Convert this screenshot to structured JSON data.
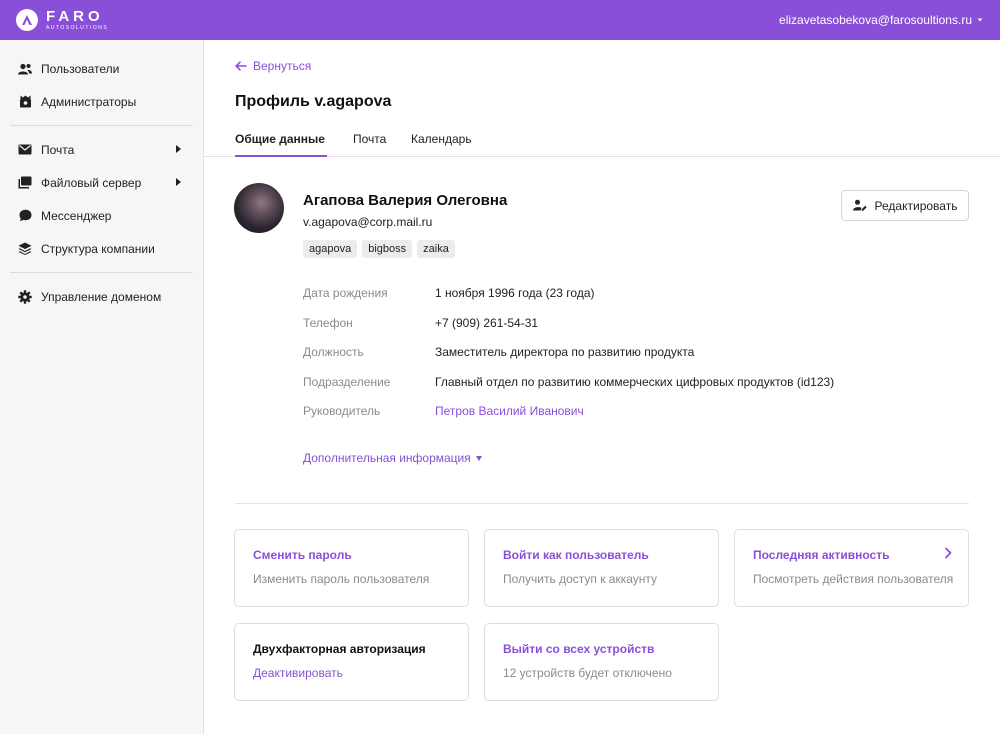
{
  "header": {
    "brand_name": "FARO",
    "brand_sub": "AUTOSOLUTIONS",
    "account_email": "elizavetasobekova@farosoultions.ru"
  },
  "sidebar": {
    "items": [
      {
        "label": "Пользователи",
        "icon": "users-icon"
      },
      {
        "label": "Администраторы",
        "icon": "admins-icon"
      },
      {
        "label": "Почта",
        "icon": "mail-icon"
      },
      {
        "label": "Файловый сервер",
        "icon": "files-icon"
      },
      {
        "label": "Мессенджер",
        "icon": "chat-icon"
      },
      {
        "label": "Структура компании",
        "icon": "layers-icon"
      },
      {
        "label": "Управление доменом",
        "icon": "gear-icon"
      }
    ]
  },
  "main": {
    "back_label": "Вернуться",
    "page_title": "Профиль v.agapova",
    "tabs": [
      {
        "label": "Общие данные"
      },
      {
        "label": "Почта"
      },
      {
        "label": "Календарь"
      }
    ],
    "profile": {
      "full_name": "Агапова Валерия Олеговна",
      "email": "v.agapova@corp.mail.ru",
      "tags": [
        "agapova",
        "bigboss",
        "zaika"
      ],
      "edit_label": "Редактировать"
    },
    "fields": [
      {
        "label": "Дата рождения",
        "value": "1 ноября 1996 года (23 года)"
      },
      {
        "label": "Телефон",
        "value": "+7 (909) 261-54-31"
      },
      {
        "label": "Должность",
        "value": "Заместитель директора по развитию продукта"
      },
      {
        "label": "Подразделение",
        "value": "Главный отдел по развитию коммерческих цифровых продуктов (id123)"
      },
      {
        "label": "Руководитель",
        "value": "Петров Василий Иванович"
      }
    ],
    "more_info_label": "Дополнительная информация",
    "cards": [
      {
        "title": "Сменить пароль",
        "subtitle": "Изменить пароль пользователя"
      },
      {
        "title": "Войти как пользователь",
        "subtitle": "Получить доступ к аккаунту"
      },
      {
        "title": "Последняя активность",
        "subtitle": "Посмотреть действия пользователя"
      },
      {
        "title": "Двухфакторная авторизация",
        "subtitle": "Деактивировать"
      },
      {
        "title": "Выйти со всех устройств",
        "subtitle": "12 устройств будет отключено"
      }
    ]
  },
  "colors": {
    "accent": "#8a4fd8",
    "muted_text": "#8a8a90",
    "sidebar_bg": "#f6f6f7"
  }
}
